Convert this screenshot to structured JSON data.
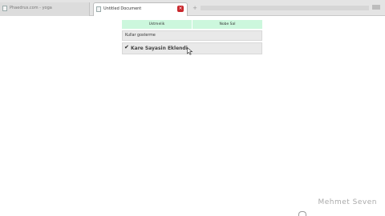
{
  "browser": {
    "tabs": [
      {
        "label": "Phaedrus.com - yoga"
      },
      {
        "label": "Untitled Document"
      }
    ],
    "new_tab_symbol": "+",
    "close_symbol": "×"
  },
  "menu": {
    "header_left": "Ustmelik",
    "header_right": "Nobe Sal",
    "row1_text": "Kullar gosterme",
    "row2_text": "Kare Sayasin Eklendi"
  },
  "watermark": {
    "name": "Mehmet Seven"
  },
  "colors": {
    "header_bg": "#ccf7dd",
    "row_bg": "#e9e9e9",
    "close_button": "#c9282d"
  },
  "icons": {
    "check": "check-icon",
    "cursor": "mouse-cursor-icon"
  }
}
